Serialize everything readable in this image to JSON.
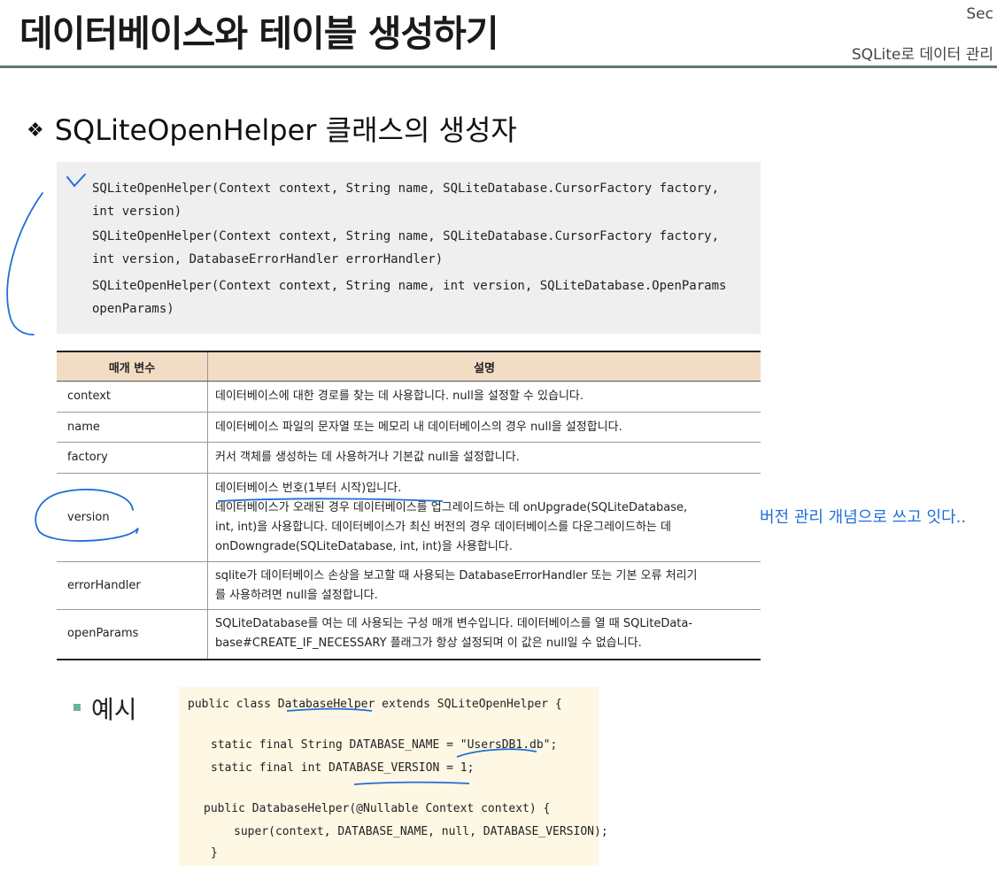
{
  "header": {
    "title": "데이터베이스와 테이블 생성하기",
    "section": "Sec",
    "subtitle": "SQLite로 데이터 관리"
  },
  "heading": {
    "bullet": "❖",
    "text": "SQLiteOpenHelper 클래스의 생성자"
  },
  "constructors": [
    "SQLiteOpenHelper(Context context, String name, SQLiteDatabase.CursorFactory factory,",
    "int version)",
    "SQLiteOpenHelper(Context context, String name, SQLiteDatabase.CursorFactory factory,",
    "int version, DatabaseErrorHandler errorHandler)",
    "SQLiteOpenHelper(Context context, String name, int version, SQLiteDatabase.OpenParams",
    "openParams)"
  ],
  "table": {
    "headers": [
      "매개 변수",
      "설명"
    ],
    "rows": [
      {
        "param": "context",
        "desc": [
          "데이터베이스에 대한 경로를 찾는 데 사용합니다. null을 설정할 수 있습니다."
        ]
      },
      {
        "param": "name",
        "desc": [
          "데이터베이스 파일의 문자열 또는 메모리 내 데이터베이스의 경우 null을 설정합니다."
        ]
      },
      {
        "param": "factory",
        "desc": [
          "커서 객체를 생성하는 데 사용하거나 기본값 null을 설정합니다."
        ]
      },
      {
        "param": "version",
        "desc": [
          "데이터베이스 번호(1부터 시작)입니다.",
          "데이터베이스가 오래된 경우 데이터베이스를 업그레이드하는 데 onUpgrade(SQLiteDatabase,",
          "int, int)을 사용합니다. 데이터베이스가 최신 버전의 경우 데이터베이스를 다운그레이드하는 데",
          "onDowngrade(SQLiteDatabase, int, int)을 사용합니다."
        ]
      },
      {
        "param": "errorHandler",
        "desc": [
          "sqlite가 데이터베이스 손상을 보고할 때 사용되는 DatabaseErrorHandler 또는 기본 오류 처리기",
          "를 사용하려면 null을 설정합니다."
        ]
      },
      {
        "param": "openParams",
        "desc": [
          "SQLiteDatabase를 여는 데 사용되는 구성 매개 변수입니다. 데이터베이스를 열 때 SQLiteData-",
          "base#CREATE_IF_NECESSARY 플래그가 항상 설정되며 이 값은 null일 수 없습니다."
        ]
      }
    ]
  },
  "note": "버전 관리 개념으로 쓰고 잇다..",
  "example": {
    "label": "예시",
    "code": [
      "public class DatabaseHelper extends SQLiteOpenHelper {",
      "static final String DATABASE_NAME = \"UsersDB1.db\";",
      "static final int DATABASE_VERSION = 1;",
      "public DatabaseHelper(@Nullable Context context) {",
      "super(context, DATABASE_NAME, null, DATABASE_VERSION);",
      "}"
    ]
  }
}
